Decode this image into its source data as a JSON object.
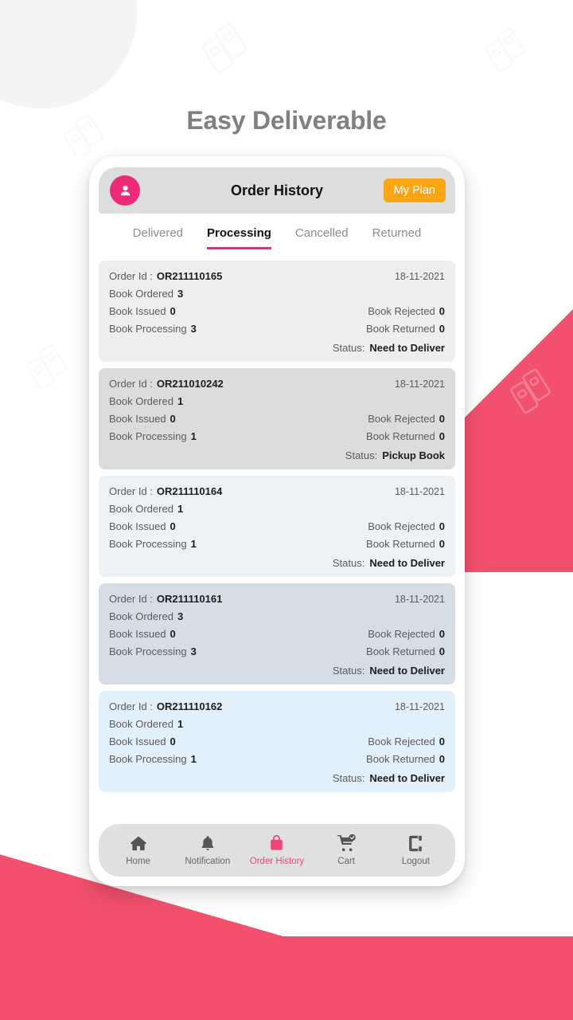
{
  "page": {
    "heading": "Easy Deliverable",
    "brand_pink": "#f2506c",
    "accent_magenta": "#ee2a7b",
    "accent_orange": "#fba414"
  },
  "appbar": {
    "title": "Order History",
    "my_plan_label": "My Plan",
    "avatar_icon": "user-avatar-icon"
  },
  "tabs": [
    {
      "label": "Delivered",
      "active": false
    },
    {
      "label": "Processing",
      "active": true
    },
    {
      "label": "Cancelled",
      "active": false
    },
    {
      "label": "Returned",
      "active": false
    }
  ],
  "labels": {
    "order_id": "Order Id :",
    "book_ordered": "Book Ordered",
    "book_issued": "Book Issued",
    "book_processing": "Book Processing",
    "book_rejected": "Book Rejected",
    "book_returned": "Book Returned",
    "status": "Status:"
  },
  "orders": [
    {
      "order_id": "OR211110165",
      "date": "18-11-2021",
      "book_ordered": "3",
      "book_issued": "0",
      "book_processing": "3",
      "book_rejected": "0",
      "book_returned": "0",
      "status": "Need to Deliver",
      "bg": "#eeeeee"
    },
    {
      "order_id": "OR211010242",
      "date": "18-11-2021",
      "book_ordered": "1",
      "book_issued": "0",
      "book_processing": "1",
      "book_rejected": "0",
      "book_returned": "0",
      "status": "Pickup Book",
      "bg": "#dcdcdc"
    },
    {
      "order_id": "OR211110164",
      "date": "18-11-2021",
      "book_ordered": "1",
      "book_issued": "0",
      "book_processing": "1",
      "book_rejected": "0",
      "book_returned": "0",
      "status": "Need to Deliver",
      "bg": "#eef1f3"
    },
    {
      "order_id": "OR211110161",
      "date": "18-11-2021",
      "book_ordered": "3",
      "book_issued": "0",
      "book_processing": "3",
      "book_rejected": "0",
      "book_returned": "0",
      "status": "Need to Deliver",
      "bg": "#d6dde4"
    },
    {
      "order_id": "OR211110162",
      "date": "18-11-2021",
      "book_ordered": "1",
      "book_issued": "0",
      "book_processing": "1",
      "book_rejected": "0",
      "book_returned": "0",
      "status": "Need to Deliver",
      "bg": "#e2f0fb"
    }
  ],
  "bottom_nav": [
    {
      "label": "Home",
      "icon": "home-icon",
      "active": false
    },
    {
      "label": "Notification",
      "icon": "bell-icon",
      "active": false
    },
    {
      "label": "Order History",
      "icon": "shopping-bag-icon",
      "active": true
    },
    {
      "label": "Cart",
      "icon": "cart-check-icon",
      "active": false
    },
    {
      "label": "Logout",
      "icon": "logout-icon",
      "active": false
    }
  ]
}
